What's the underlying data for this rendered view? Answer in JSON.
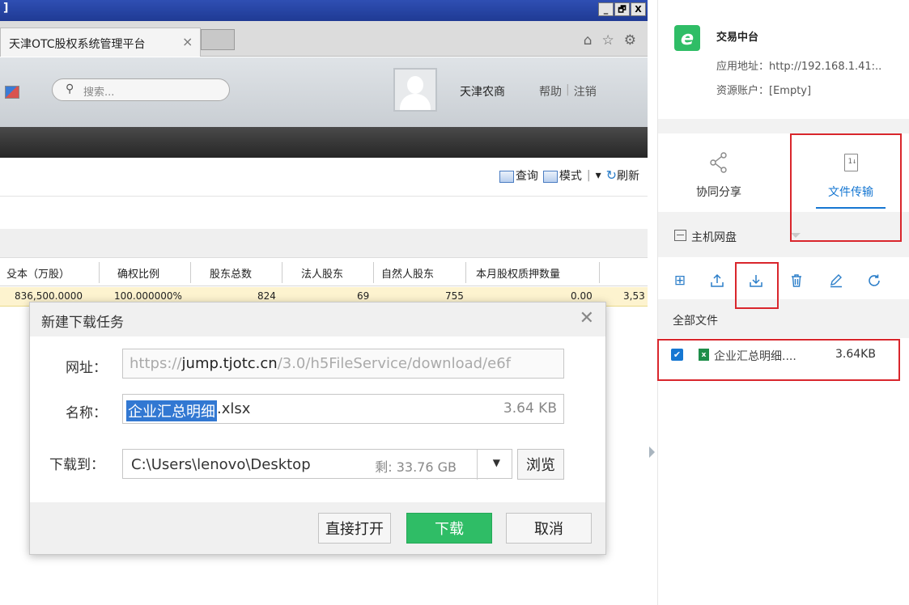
{
  "browser": {
    "window_title_fragment": "]",
    "window_buttons": [
      "_",
      "🗗",
      "X"
    ],
    "tab_title": "天津OTC股权系统管理平台",
    "tab_close": "×"
  },
  "app_header": {
    "search_placeholder": "搜索...",
    "user_name": "天津农商",
    "help_link": "帮助",
    "link_separator": "|",
    "logout_link": "注销"
  },
  "grid_toolbar": {
    "query_label": "查询",
    "mode_label": "模式",
    "dropdown_glyph": "▾",
    "refresh_label": "刷新",
    "separator": "|"
  },
  "grid": {
    "headers": [
      "殳本（万股）",
      "确权比例",
      "股东总数",
      "法人股东",
      "自然人股东",
      "本月股权质押数量"
    ],
    "row": [
      "836,500.0000",
      "100.000000%",
      "824",
      "69",
      "755",
      "0.00",
      "3,53"
    ]
  },
  "dialog": {
    "title": "新建下载任务",
    "url_label": "网址：",
    "url_prefix": "https://",
    "url_domain": "jump.tjotc.cn",
    "url_path": "/3.0/h5FileService/download/e6f",
    "name_label": "名称：",
    "name_selected": "企业汇总明细",
    "name_ext": ".xlsx",
    "name_size": "3.64 KB",
    "save_to_label": "下载到：",
    "save_path": "C:\\Users\\lenovo\\Desktop",
    "free_space": "剩: 33.76 GB",
    "browse_button": "浏览",
    "open_directly_button": "直接打开",
    "download_button": "下载",
    "cancel_button": "取消"
  },
  "panel": {
    "app_icon_letter": "e",
    "app_name": "交易中台",
    "app_url": "应用地址：http://192.168.1.41:..",
    "resource_account": "资源账户：[Empty]",
    "tabs": [
      {
        "label": "协同分享",
        "icon": "share-icon"
      },
      {
        "label": "文件传输",
        "icon": "file-transfer-icon",
        "active": true
      }
    ],
    "disk_label": "主机网盘",
    "all_files_label": "全部文件",
    "file": {
      "checked": true,
      "name": "企业汇总明细....",
      "size": "3.64KB"
    }
  },
  "colors": {
    "accent_blue": "#1677d2",
    "primary_green": "#2fbd66",
    "annotation_red": "#d9262c",
    "selected_row": "#fdf3cf"
  }
}
